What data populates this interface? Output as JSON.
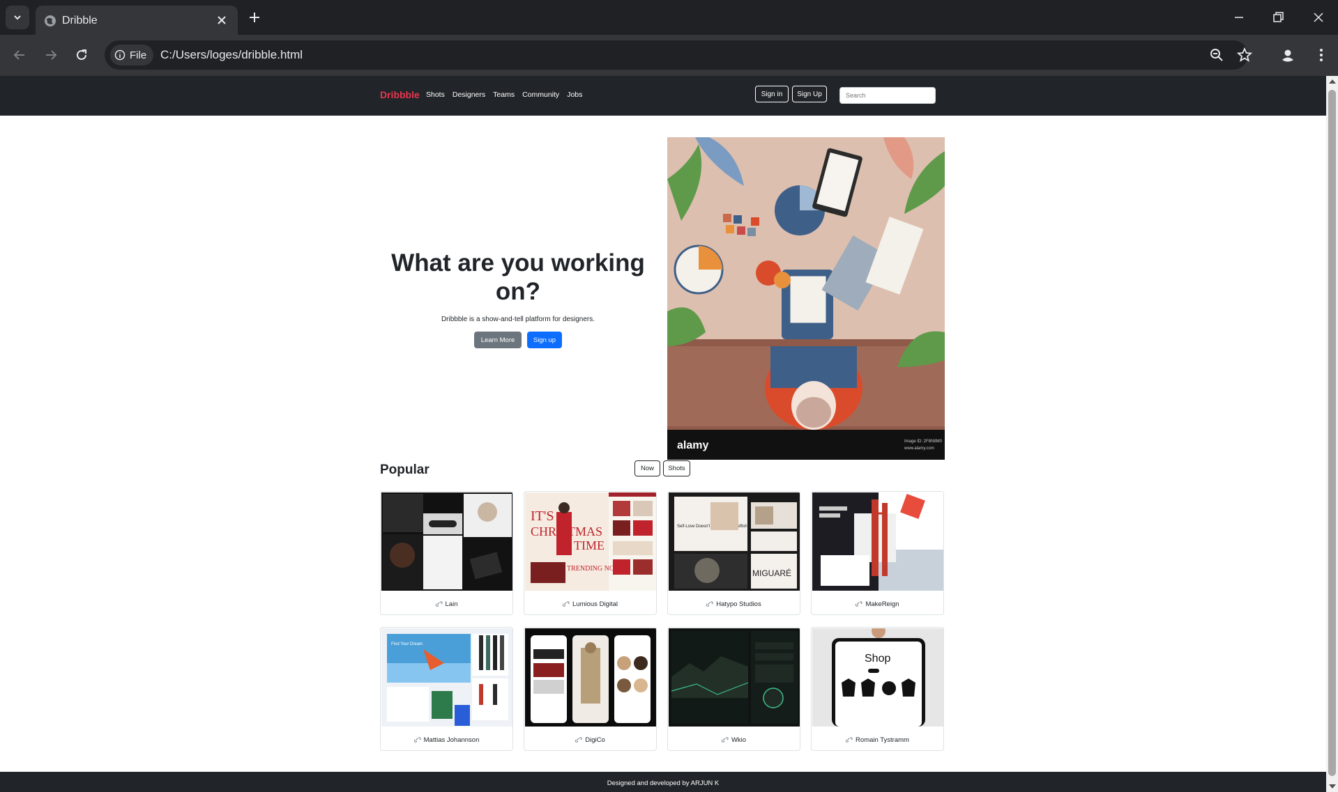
{
  "browser": {
    "tab_title": "Dribble",
    "url_chip": "File",
    "url": "C:/Users/loges/dribble.html"
  },
  "site": {
    "brand": "Dribbble",
    "nav_links": [
      "Shots",
      "Designers",
      "Teams",
      "Community",
      "Jobs"
    ],
    "sign_in": "Sign in",
    "sign_up": "Sign Up",
    "search_placeholder": "Search"
  },
  "hero": {
    "title": "What are you working on?",
    "subtitle": "Dribbble is a show-and-tell platform for designers.",
    "learn_more": "Learn More",
    "sign_up": "Sign up",
    "image_watermark": "alamy",
    "image_tag_1": "Image ID: 2F8N8M0",
    "image_tag_2": "www.alamy.com"
  },
  "popular": {
    "heading": "Popular",
    "filters": [
      "Now",
      "Shots"
    ],
    "cards": [
      {
        "name": "Lain"
      },
      {
        "name": "Lumious Digital",
        "thumb_text_1": "IT'S",
        "thumb_text_2": "CHRISTMAS",
        "thumb_text_3": "TIME",
        "thumb_text_4": "TRENDING NOW"
      },
      {
        "name": "Hatypo Studios",
        "thumb_text_1": "Self-Love Doesn't Mean Being Selfish",
        "thumb_text_2": "MIGUARÉ"
      },
      {
        "name": "MakeReign"
      },
      {
        "name": "Mattias Johannson",
        "thumb_text_1": "Find Your Dream"
      },
      {
        "name": "DigiCo"
      },
      {
        "name": "Wkio"
      },
      {
        "name": "Romain Tystramm",
        "thumb_text_1": "Shop"
      }
    ]
  },
  "footer": {
    "text": "Designed and developed by ARJUN K"
  },
  "colors": {
    "brand": "#e8364f",
    "dark": "#212529",
    "primary": "#0d6efd",
    "secondary": "#6c757d"
  }
}
